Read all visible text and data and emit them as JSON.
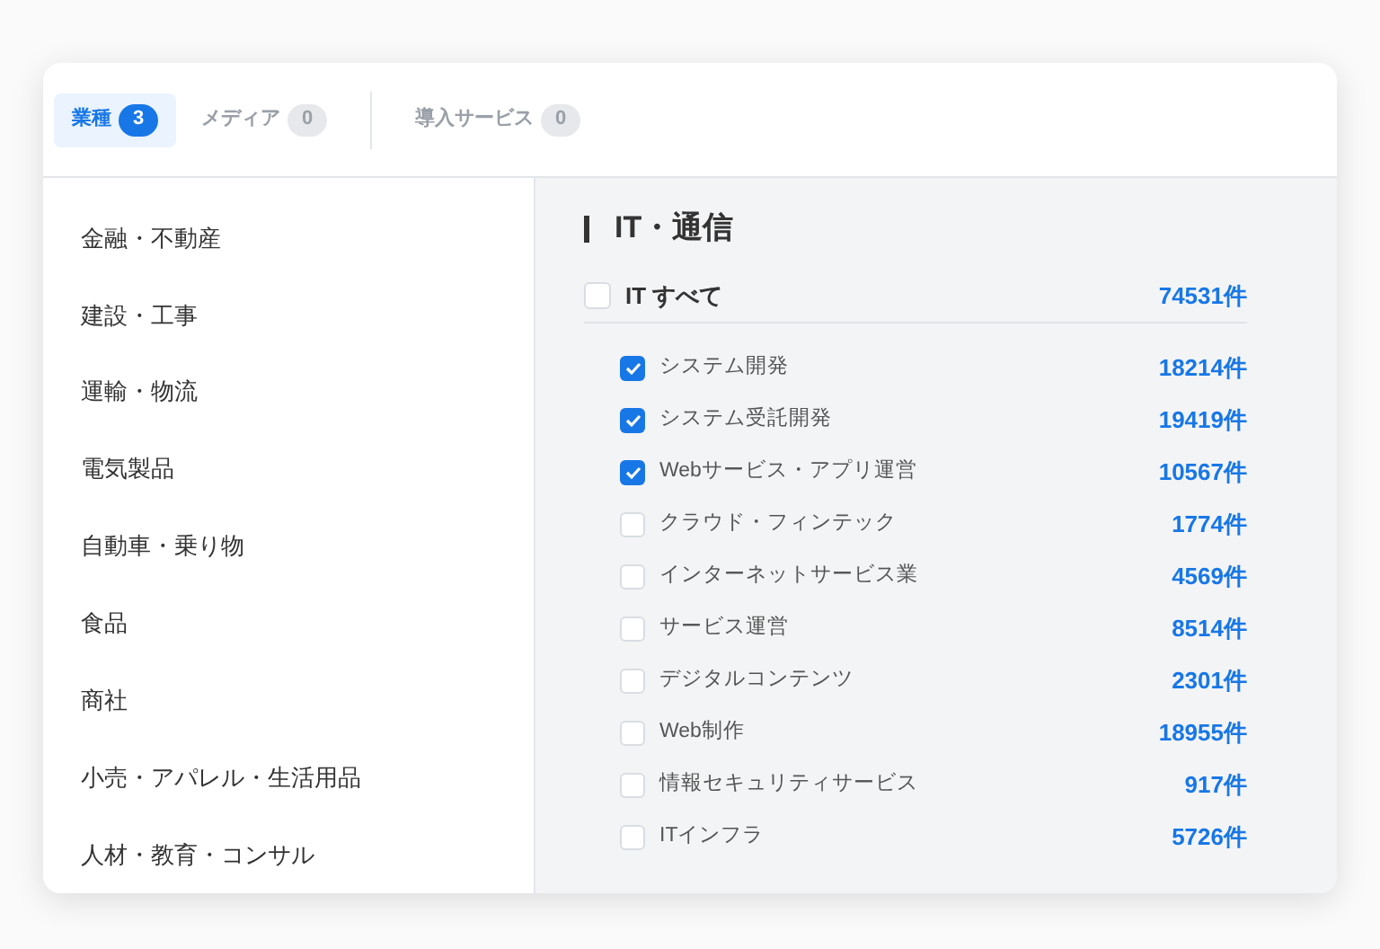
{
  "tabs": [
    {
      "label": "業種",
      "count": "3",
      "selected": true
    },
    {
      "label": "メディア",
      "count": "0",
      "selected": false
    },
    {
      "label": "導入サービス",
      "count": "0",
      "selected": false
    }
  ],
  "sidebar": {
    "items": [
      {
        "label": "金融・不動産"
      },
      {
        "label": "建設・工事"
      },
      {
        "label": "運輸・物流"
      },
      {
        "label": "電気製品"
      },
      {
        "label": "自動車・乗り物"
      },
      {
        "label": "食品"
      },
      {
        "label": "商社"
      },
      {
        "label": "小売・アパレル・生活用品"
      },
      {
        "label": "人材・教育・コンサル"
      }
    ]
  },
  "section": {
    "title": "IT・通信",
    "all": {
      "label": "IT すべて",
      "count": "74531件",
      "checked": false
    },
    "items": [
      {
        "label": "システム開発",
        "count": "18214件",
        "checked": true
      },
      {
        "label": "システム受託開発",
        "count": "19419件",
        "checked": true
      },
      {
        "label": "Webサービス・アプリ運営",
        "count": "10567件",
        "checked": true
      },
      {
        "label": "クラウド・フィンテック",
        "count": "1774件",
        "checked": false
      },
      {
        "label": "インターネットサービス業",
        "count": "4569件",
        "checked": false
      },
      {
        "label": "サービス運営",
        "count": "8514件",
        "checked": false
      },
      {
        "label": "デジタルコンテンツ",
        "count": "2301件",
        "checked": false
      },
      {
        "label": "Web制作",
        "count": "18955件",
        "checked": false
      },
      {
        "label": "情報セキュリティサービス",
        "count": "917件",
        "checked": false
      },
      {
        "label": "ITインフラ",
        "count": "5726件",
        "checked": false
      }
    ]
  }
}
